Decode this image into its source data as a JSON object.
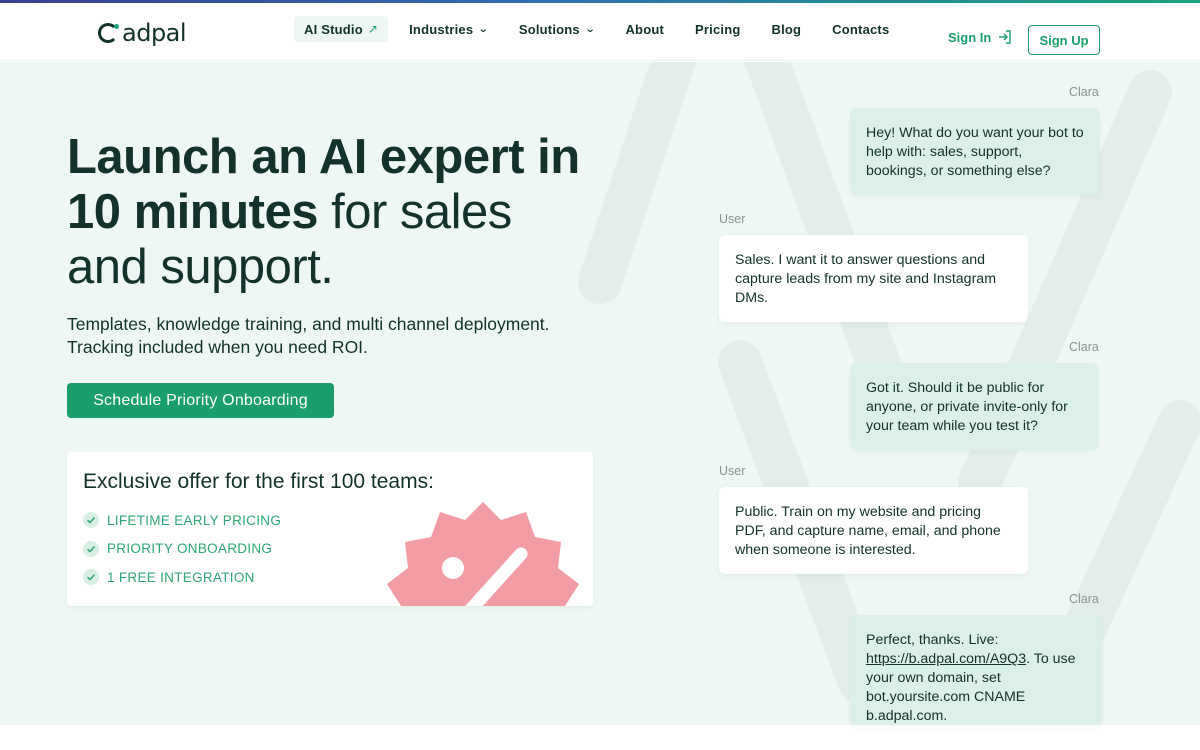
{
  "colors": {
    "brand_green": "#1a9f6c",
    "dark": "#12322b",
    "hero_bg": "#eef7f3",
    "bot_bubble": "#dcefe8",
    "badge_pink": "#f29ca5"
  },
  "header": {
    "logo_text": "adpal",
    "nav": [
      {
        "label": "AI Studio",
        "icon": "arrow-up-right-icon"
      },
      {
        "label": "Industries",
        "icon": "chevron-down-icon"
      },
      {
        "label": "Solutions",
        "icon": "chevron-down-icon"
      },
      {
        "label": "About"
      },
      {
        "label": "Pricing"
      },
      {
        "label": "Blog"
      },
      {
        "label": "Contacts"
      }
    ],
    "sign_in": "Sign In",
    "sign_up": "Sign Up"
  },
  "hero": {
    "headline_bold_1": "Launch an AI expert in",
    "headline_bold_2": "10 minutes",
    "headline_light_1": " for sales",
    "headline_light_2": "and support.",
    "subtitle_line_1": "Templates, knowledge training, and multi channel deployment.",
    "subtitle_line_2": "Tracking included when you need ROI.",
    "cta": "Schedule Priority Onboarding"
  },
  "offer": {
    "title": "Exclusive offer for the first 100 teams:",
    "items": [
      "LIFETIME EARLY PRICING",
      "PRIORITY ONBOARDING",
      "1 FREE INTEGRATION"
    ],
    "badge_icon": "percent-badge-icon"
  },
  "chat": [
    {
      "sender": "Clara",
      "text": "Hey! What do you want your bot to help with: sales, support, bookings, or something else?"
    },
    {
      "sender": "User",
      "text": "Sales. I want it to answer questions and capture leads from my site and Instagram DMs."
    },
    {
      "sender": "Clara",
      "text": "Got it. Should it be public for anyone, or private invite-only for your team while you test it?"
    },
    {
      "sender": "User",
      "text": "Public. Train on my website and pricing PDF, and capture name, email, and phone when someone is interested."
    },
    {
      "sender": "Clara",
      "text_before": "Perfect, thanks. Live: ",
      "link": "https://b.adpal.com/A9Q3",
      "text_after": ". To use your own domain, set bot.yoursite.com CNAME b.adpal.com."
    }
  ]
}
